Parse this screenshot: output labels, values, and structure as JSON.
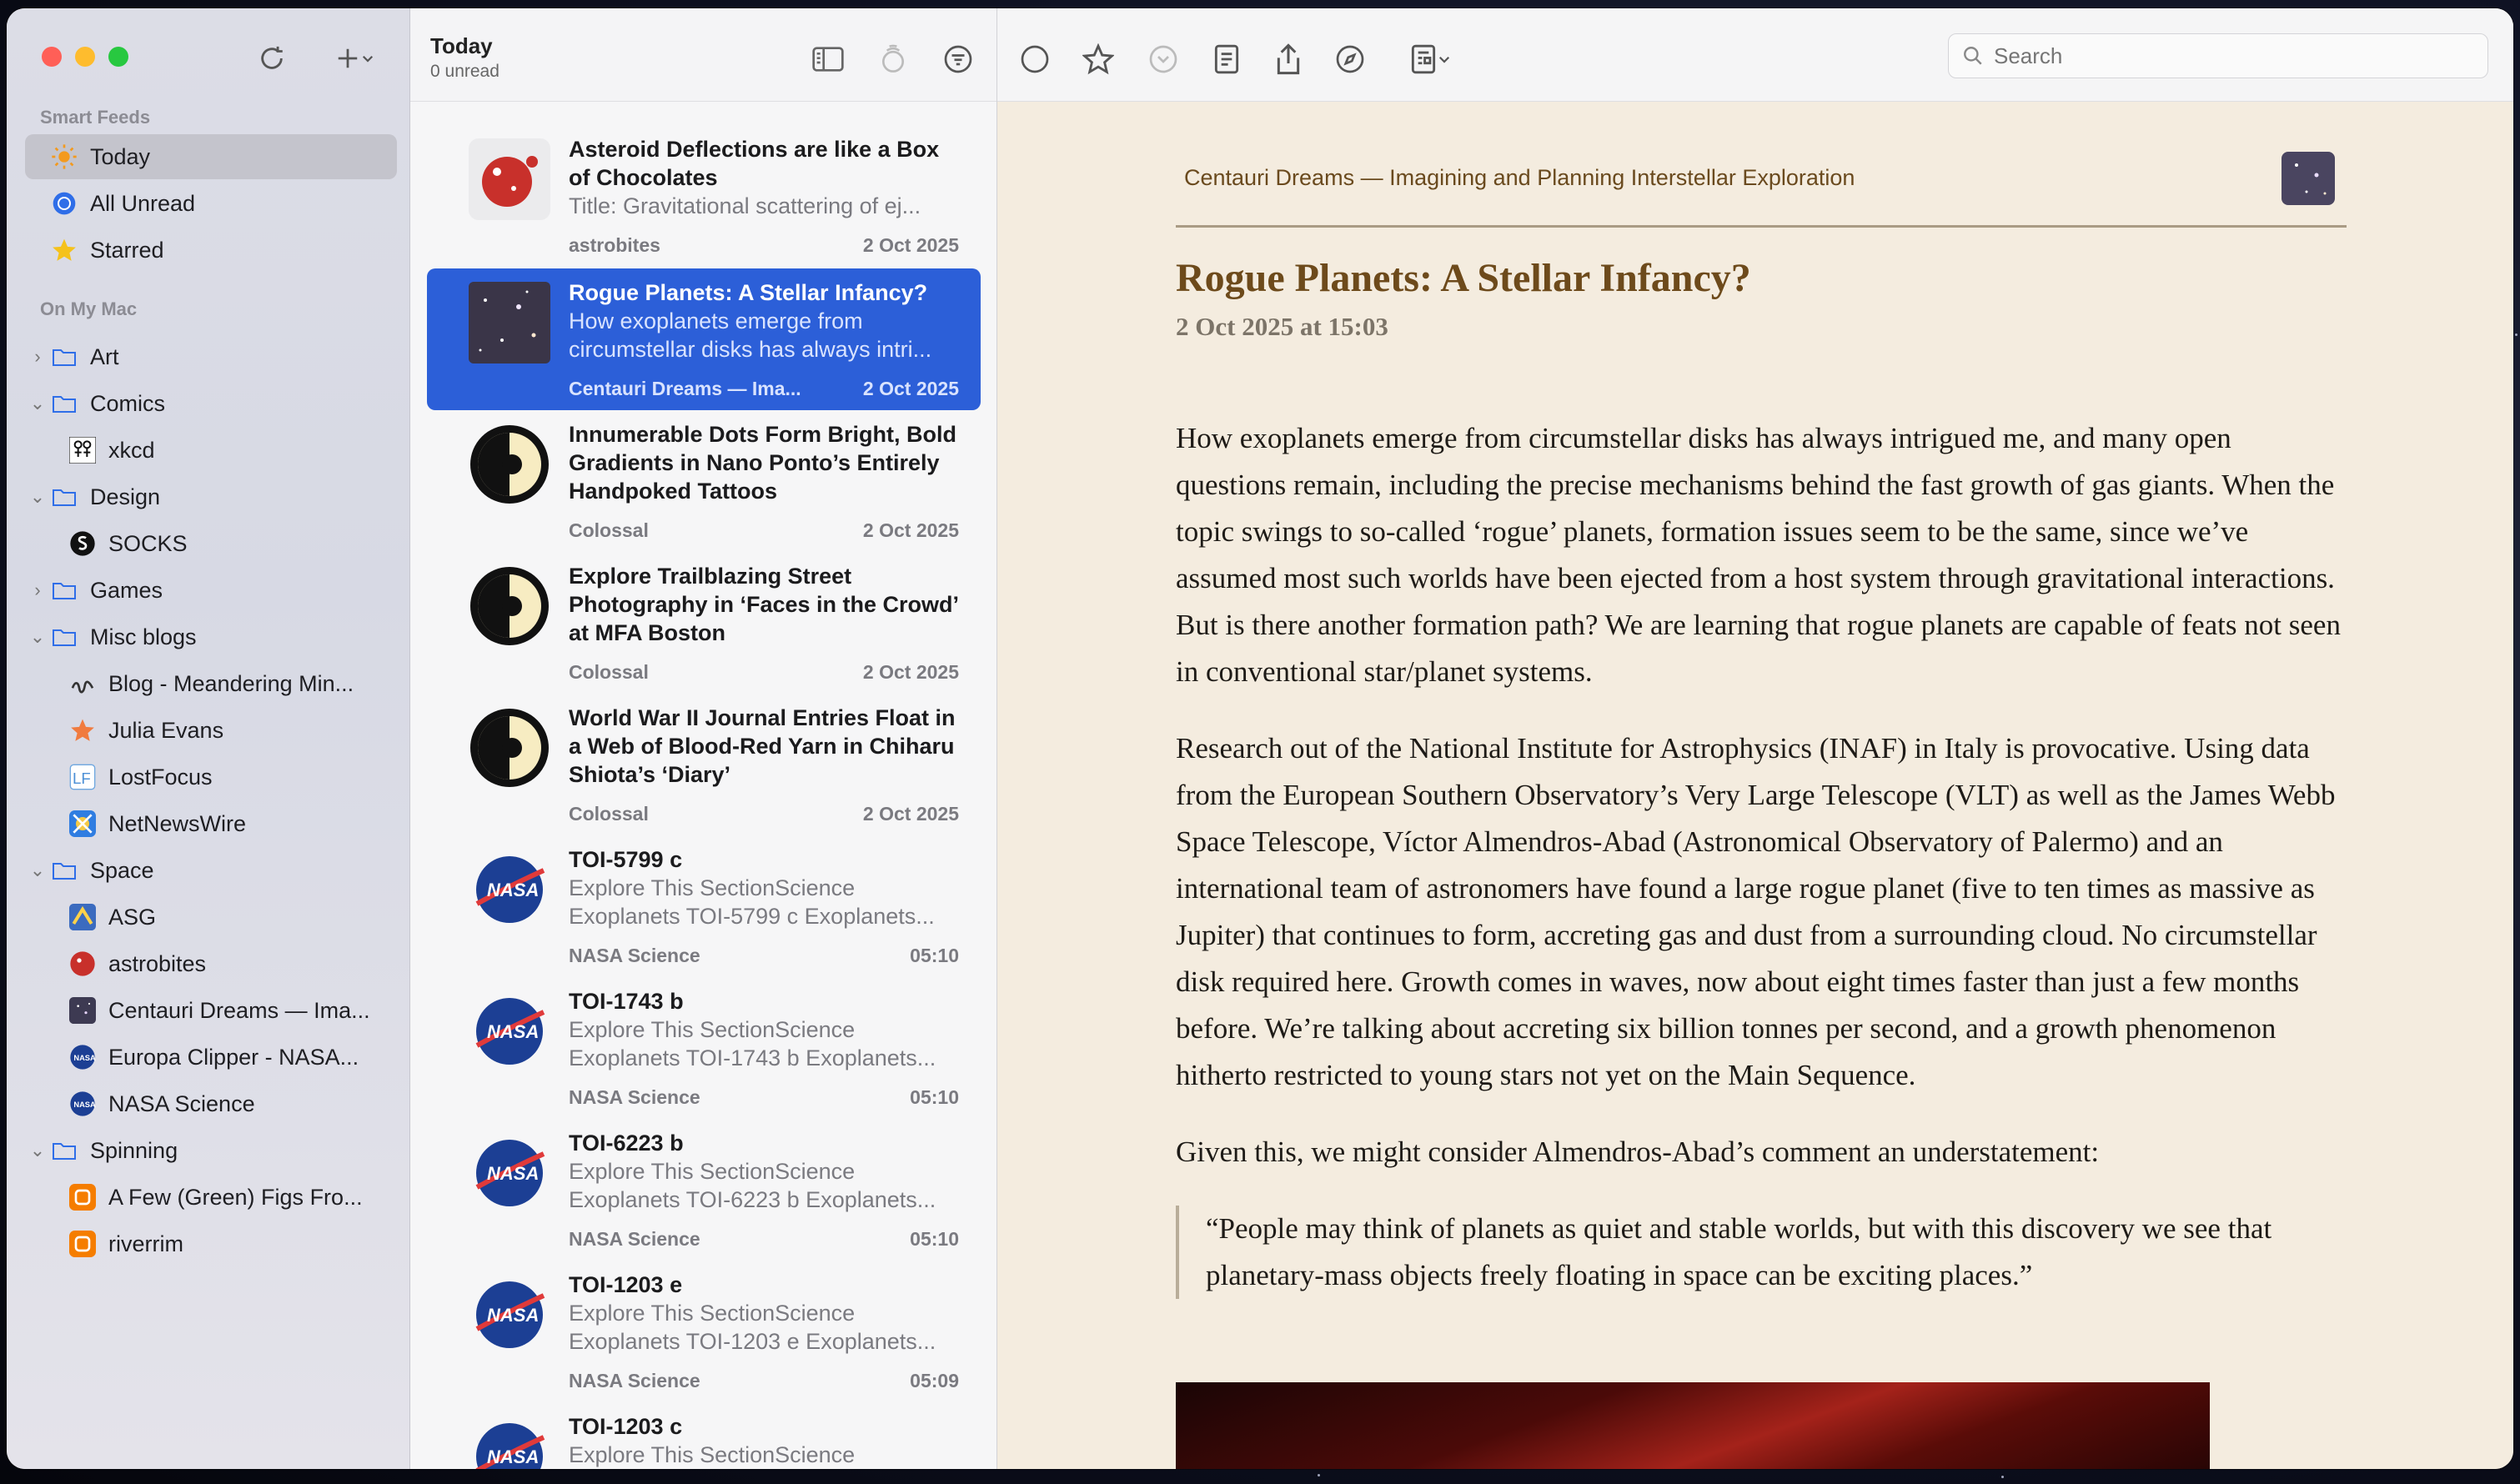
{
  "sidebar": {
    "smart_feeds_label": "Smart Feeds",
    "smart_feeds": [
      {
        "label": "Today",
        "icon": "sun-icon"
      },
      {
        "label": "All Unread",
        "icon": "unread-circle-icon"
      },
      {
        "label": "Starred",
        "icon": "star-icon"
      }
    ],
    "on_my_mac_label": "On My Mac",
    "tree": [
      {
        "label": "Art",
        "type": "folder",
        "expanded": false
      },
      {
        "label": "Comics",
        "type": "folder",
        "expanded": true
      },
      {
        "label": "xkcd",
        "type": "feed",
        "icon": "xkcd-icon"
      },
      {
        "label": "Design",
        "type": "folder",
        "expanded": true
      },
      {
        "label": "SOCKS",
        "type": "feed",
        "icon": "socks-icon"
      },
      {
        "label": "Games",
        "type": "folder",
        "expanded": false
      },
      {
        "label": "Misc blogs",
        "type": "folder",
        "expanded": true
      },
      {
        "label": "Blog - Meandering Min...",
        "type": "feed",
        "icon": "meandering-icon"
      },
      {
        "label": "Julia Evans",
        "type": "feed",
        "icon": "julia-evans-icon"
      },
      {
        "label": "LostFocus",
        "type": "feed",
        "icon": "lostfocus-icon"
      },
      {
        "label": "NetNewsWire",
        "type": "feed",
        "icon": "netnewswire-icon"
      },
      {
        "label": "Space",
        "type": "folder",
        "expanded": true
      },
      {
        "label": "ASG",
        "type": "feed",
        "icon": "asg-icon"
      },
      {
        "label": "astrobites",
        "type": "feed",
        "icon": "astrobites-icon"
      },
      {
        "label": "Centauri Dreams — Ima...",
        "type": "feed",
        "icon": "centauri-icon"
      },
      {
        "label": "Europa Clipper - NASA...",
        "type": "feed",
        "icon": "nasa-icon"
      },
      {
        "label": "NASA Science",
        "type": "feed",
        "icon": "nasa-icon"
      },
      {
        "label": "Spinning",
        "type": "folder",
        "expanded": true
      },
      {
        "label": "A Few (Green) Figs Fro...",
        "type": "feed",
        "icon": "blogger-icon"
      },
      {
        "label": "riverrim",
        "type": "feed",
        "icon": "blogger-icon"
      }
    ]
  },
  "list": {
    "title": "Today",
    "subtitle": "0 unread",
    "items": [
      {
        "title": "Asteroid Deflections are like a Box of Chocolates",
        "summary": "Title: Gravitational scattering of ej...",
        "source": "astrobites",
        "date": "2 Oct 2025",
        "icon": "astrobites-icon"
      },
      {
        "title": "Rogue Planets: A Stellar Infancy?",
        "summary": "How exoplanets emerge from circumstellar disks has always intri...",
        "source": "Centauri Dreams — Ima...",
        "date": "2 Oct 2025",
        "icon": "centauri-icon",
        "selected": true
      },
      {
        "title": "Innumerable Dots Form Bright, Bold Gradients in Nano Ponto’s Entirely Handpoked Tattoos",
        "summary": "",
        "source": "Colossal",
        "date": "2 Oct 2025",
        "icon": "colossal-icon"
      },
      {
        "title": "Explore Trailblazing Street Photography in ‘Faces in the Crowd’ at MFA Boston",
        "summary": "",
        "source": "Colossal",
        "date": "2 Oct 2025",
        "icon": "colossal-icon"
      },
      {
        "title": "World War II Journal Entries Float in a Web of Blood-Red Yarn in Chiharu Shiota’s ‘Diary’",
        "summary": "",
        "source": "Colossal",
        "date": "2 Oct 2025",
        "icon": "colossal-icon"
      },
      {
        "title": "TOI-5799 c",
        "summary": "Explore This SectionScience Exoplanets TOI-5799 c Exoplanets...",
        "source": "NASA Science",
        "date": "05:10",
        "icon": "nasa-icon"
      },
      {
        "title": "TOI-1743 b",
        "summary": "Explore This SectionScience Exoplanets TOI-1743 b Exoplanets...",
        "source": "NASA Science",
        "date": "05:10",
        "icon": "nasa-icon"
      },
      {
        "title": "TOI-6223 b",
        "summary": "Explore This SectionScience Exoplanets TOI-6223 b Exoplanets...",
        "source": "NASA Science",
        "date": "05:10",
        "icon": "nasa-icon"
      },
      {
        "title": "TOI-1203 e",
        "summary": "Explore This SectionScience Exoplanets TOI-1203 e Exoplanets...",
        "source": "NASA Science",
        "date": "05:09",
        "icon": "nasa-icon"
      },
      {
        "title": "TOI-1203 c",
        "summary": "Explore This SectionScience",
        "source": "",
        "date": "",
        "icon": "nasa-icon"
      }
    ]
  },
  "reader": {
    "search_placeholder": "Search",
    "feed_name": "Centauri Dreams — Imagining and Planning Interstellar Exploration",
    "title": "Rogue Planets: A Stellar Infancy?",
    "date": "2 Oct 2025 at 15:03",
    "paragraphs": [
      "How exoplanets emerge from circumstellar disks has always intrigued me, and many open questions remain, including the precise mechanisms behind the fast growth of gas giants. When the topic swings to so-called ‘rogue’ planets, formation issues seem to be the same, since we’ve assumed most such worlds have been ejected from a host system through gravitational interactions. But is there another formation path? We are learning that rogue planets are capable of feats not seen in conventional star/planet systems.",
      "Research out of the National Institute for Astrophysics (INAF) in Italy is provocative. Using data from the European Southern Observatory’s Very Large Telescope (VLT) as well as the James Webb Space Telescope, Víctor Almendros-Abad (Astronomical Observatory of Palermo) and an international team of astronomers have found a large rogue planet (five to ten times as massive as Jupiter) that continues to form, accreting gas and dust from a surrounding cloud. No circumstellar disk required here. Growth comes in waves, now about eight times faster than just a few months before. We’re talking about accreting six billion tonnes per second, and a growth phenomenon hitherto restricted to young stars not yet on the Main Sequence.",
      "Given this, we might consider Almendros-Abad’s comment an understatement:"
    ],
    "quote": "“People may think of planets as quiet and stable worlds, but with this discovery we see that planetary-mass objects freely floating in space can be exciting places.”"
  },
  "colors": {
    "selection": "#2c5fd8",
    "article_title": "#6d4a1b",
    "reader_bg": "#f4ecdf"
  }
}
